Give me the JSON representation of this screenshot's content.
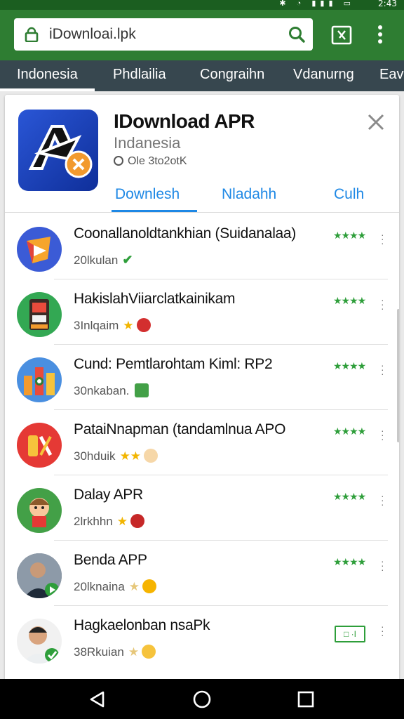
{
  "status_bar": {
    "time": "2:43",
    "icons": [
      "bluetooth-icon",
      "wifi-icon",
      "signal-icon",
      "battery-icon"
    ]
  },
  "browser": {
    "url": "iDownloai.lpk",
    "icons": {
      "lock": "lock-icon",
      "search": "search-icon",
      "tab": "tab-switcher-icon",
      "menu": "more-vert-icon"
    }
  },
  "country_tabs": [
    {
      "label": "Indonesia",
      "active": true
    },
    {
      "label": "Phdlailia"
    },
    {
      "label": "Congraihn"
    },
    {
      "label": "Vdanurng"
    },
    {
      "label": "Eav"
    }
  ],
  "app_card": {
    "title": "IDownload APR",
    "subtitle": "Indanesia",
    "meta": "Ole 3to2otK",
    "tabs": [
      {
        "label": "Downlesh",
        "active": true
      },
      {
        "label": "Nladahh"
      },
      {
        "label": "Culh"
      }
    ],
    "close_icon": "close-icon"
  },
  "list": [
    {
      "title": "Coonallanoldtankhian (Suidanalaa)",
      "subtitle": "20lkulan",
      "badge": "verified",
      "rating": "★★★★",
      "icon": "play-store-app-icon"
    },
    {
      "title": "HakislahViiarclatkainikam",
      "subtitle": "3Inlqaim",
      "badge": "star-ghost",
      "rating": "★★★★",
      "icon": "arcade-machine-icon"
    },
    {
      "title": "Cund: Pemtlarohtam Kiml: RP2",
      "subtitle": "30nkaban.",
      "badge": "green-tile",
      "rating": "★★★★",
      "icon": "castle-game-icon"
    },
    {
      "title": "PataiNnapman (tandamlnua APO",
      "subtitle": "30hduik",
      "badge": "two-stars-face",
      "rating": "★★★★",
      "icon": "no-sign-game-icon"
    },
    {
      "title": "Dalay APR",
      "subtitle": "2lrkhhn",
      "badge": "star-ghost",
      "rating": "★★★★",
      "icon": "cartoon-kid-icon"
    },
    {
      "title": "Benda APP",
      "subtitle": "20lknaina",
      "badge": "star-emoji",
      "rating": "★★★★",
      "icon": "man-photo-icon"
    },
    {
      "title": "Hagkaelonban nsaPk",
      "subtitle": "38Rkuian",
      "badge": "star-emoji",
      "rating": "open",
      "button_label": "□ ·I",
      "icon": "smiling-man-icon"
    }
  ],
  "colors": {
    "appbar": "#2e7d32",
    "tabs_bg": "#37474f",
    "accent": "#1e88e5",
    "rating_green": "#2e9e3a"
  },
  "nav_bar": [
    "back-icon",
    "home-icon",
    "recents-icon"
  ]
}
